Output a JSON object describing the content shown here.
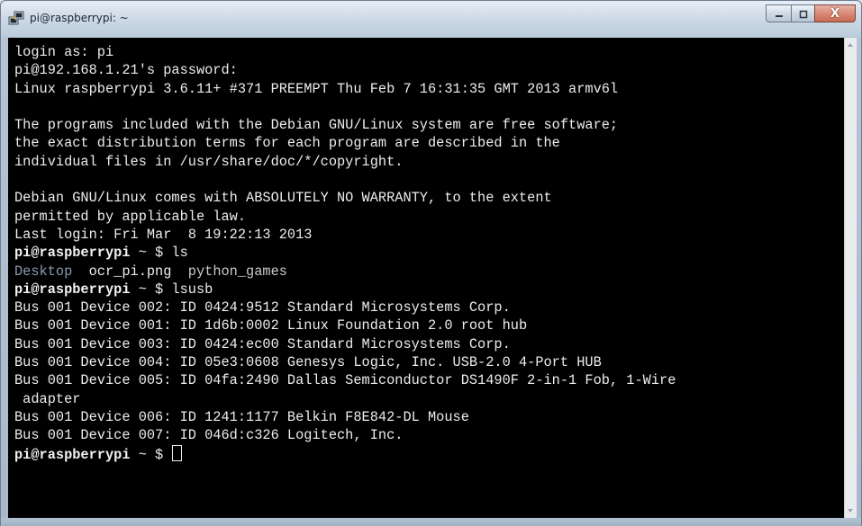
{
  "window": {
    "title": "pi@raspberrypi: ~",
    "app_icon": "putty-icon",
    "controls": {
      "minimize_icon": "minimize-icon",
      "maximize_icon": "maximize-icon",
      "close_label": "X"
    }
  },
  "terminal": {
    "foreground": "#ededed",
    "background": "#000000",
    "lines": [
      {
        "text": "login as: pi"
      },
      {
        "text": "pi@192.168.1.21's password:"
      },
      {
        "text": "Linux raspberrypi 3.6.11+ #371 PREEMPT Thu Feb 7 16:31:35 GMT 2013 armv6l"
      },
      {
        "text": ""
      },
      {
        "text": "The programs included with the Debian GNU/Linux system are free software;"
      },
      {
        "text": "the exact distribution terms for each program are described in the"
      },
      {
        "text": "individual files in /usr/share/doc/*/copyright."
      },
      {
        "text": ""
      },
      {
        "text": "Debian GNU/Linux comes with ABSOLUTELY NO WARRANTY, to the extent"
      },
      {
        "text": "permitted by applicable law."
      },
      {
        "text": "Last login: Fri Mar  8 19:22:13 2013"
      },
      {
        "prompt": "pi@raspberrypi",
        "path": " ~ $ ",
        "cmd": "ls"
      },
      {
        "ls": [
          {
            "text": "Desktop",
            "color": "#8a9bb0",
            "gap": "  "
          },
          {
            "text": "ocr_pi.png",
            "color": "#ededed",
            "gap": "  "
          },
          {
            "text": "python_games",
            "color": "#c9c9c9",
            "gap": ""
          }
        ]
      },
      {
        "prompt": "pi@raspberrypi",
        "path": " ~ $ ",
        "cmd": "lsusb"
      },
      {
        "text": "Bus 001 Device 002: ID 0424:9512 Standard Microsystems Corp."
      },
      {
        "text": "Bus 001 Device 001: ID 1d6b:0002 Linux Foundation 2.0 root hub"
      },
      {
        "text": "Bus 001 Device 003: ID 0424:ec00 Standard Microsystems Corp."
      },
      {
        "text": "Bus 001 Device 004: ID 05e3:0608 Genesys Logic, Inc. USB-2.0 4-Port HUB"
      },
      {
        "text": "Bus 001 Device 005: ID 04fa:2490 Dallas Semiconductor DS1490F 2-in-1 Fob, 1-Wire"
      },
      {
        "text": " adapter"
      },
      {
        "text": "Bus 001 Device 006: ID 1241:1177 Belkin F8E842-DL Mouse"
      },
      {
        "text": "Bus 001 Device 007: ID 046d:c326 Logitech, Inc."
      },
      {
        "prompt": "pi@raspberrypi",
        "path": " ~ $ ",
        "cmd": "",
        "cursor": true
      }
    ]
  }
}
